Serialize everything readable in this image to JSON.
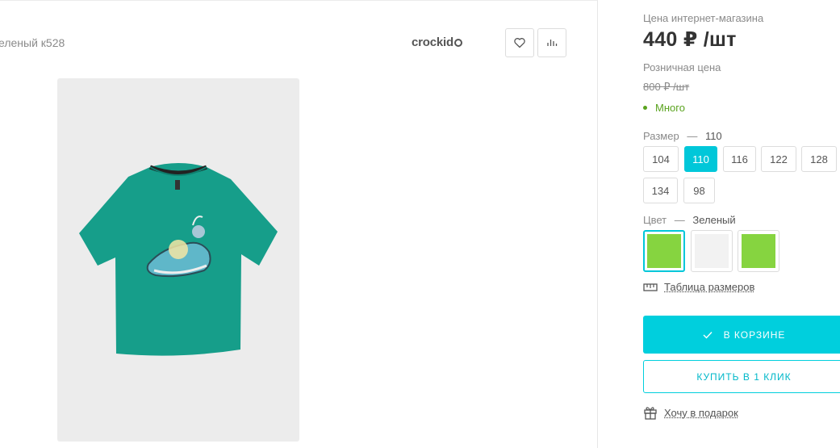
{
  "product": {
    "sku_text": "еленый к528",
    "brand": "crockid"
  },
  "price": {
    "online_label": "Цена интернет-магазина",
    "online_value": "440 ₽ /шт",
    "retail_label": "Розничная цена",
    "retail_value": "800 ₽ /шт",
    "stock": "Много"
  },
  "size": {
    "label": "Размер",
    "separator": "—",
    "selected": "110",
    "options": [
      "104",
      "110",
      "116",
      "122",
      "128",
      "134",
      "98"
    ]
  },
  "color": {
    "label": "Цвет",
    "separator": "—",
    "selected": "Зеленый",
    "swatches": [
      "#86d440",
      "#f2f2f2",
      "#86d440"
    ]
  },
  "links": {
    "size_table": "Таблица размеров",
    "gift": "Хочу в подарок"
  },
  "buttons": {
    "cart": "В КОРЗИНЕ",
    "one_click": "КУПИТЬ В 1 КЛИК"
  },
  "colors": {
    "accent": "#00cfdd",
    "stock_green": "#5aa31e"
  },
  "icons": {
    "favorite": "heart-icon",
    "compare": "bar-chart-icon",
    "check": "check-icon",
    "ruler": "ruler-icon",
    "gift": "gift-icon"
  }
}
